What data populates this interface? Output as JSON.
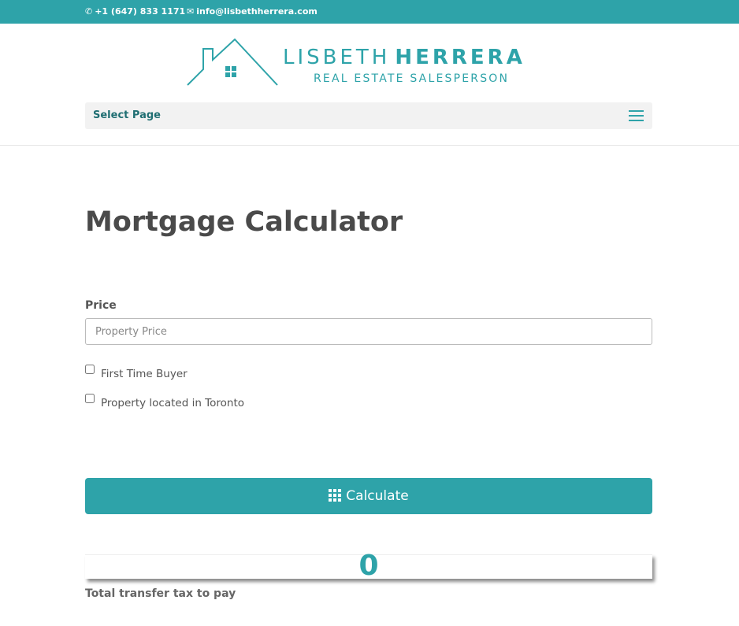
{
  "topbar": {
    "phone": "+1 (647) 833 1171",
    "email": "info@lisbethherrera.com",
    "bg_color": "#2ea3a9"
  },
  "logo": {
    "first_name": "LISBETH",
    "last_name": "HERRERA",
    "subtitle": "REAL ESTATE SALESPERSON",
    "color": "#2ea3a9"
  },
  "nav": {
    "label": "Select Page",
    "icon": "hamburger-menu-icon"
  },
  "page": {
    "title": "Mortgage Calculator"
  },
  "form": {
    "price_label": "Price",
    "price_placeholder": "Property Price",
    "price_value": "",
    "checkbox_first_time": "First Time Buyer",
    "checkbox_toronto": "Property located in Toronto",
    "calculate_label": "Calculate",
    "calculate_icon": "grid-icon"
  },
  "result": {
    "value": "0",
    "label": "Total transfer tax to pay"
  },
  "accent_color": "#2ea3a9"
}
